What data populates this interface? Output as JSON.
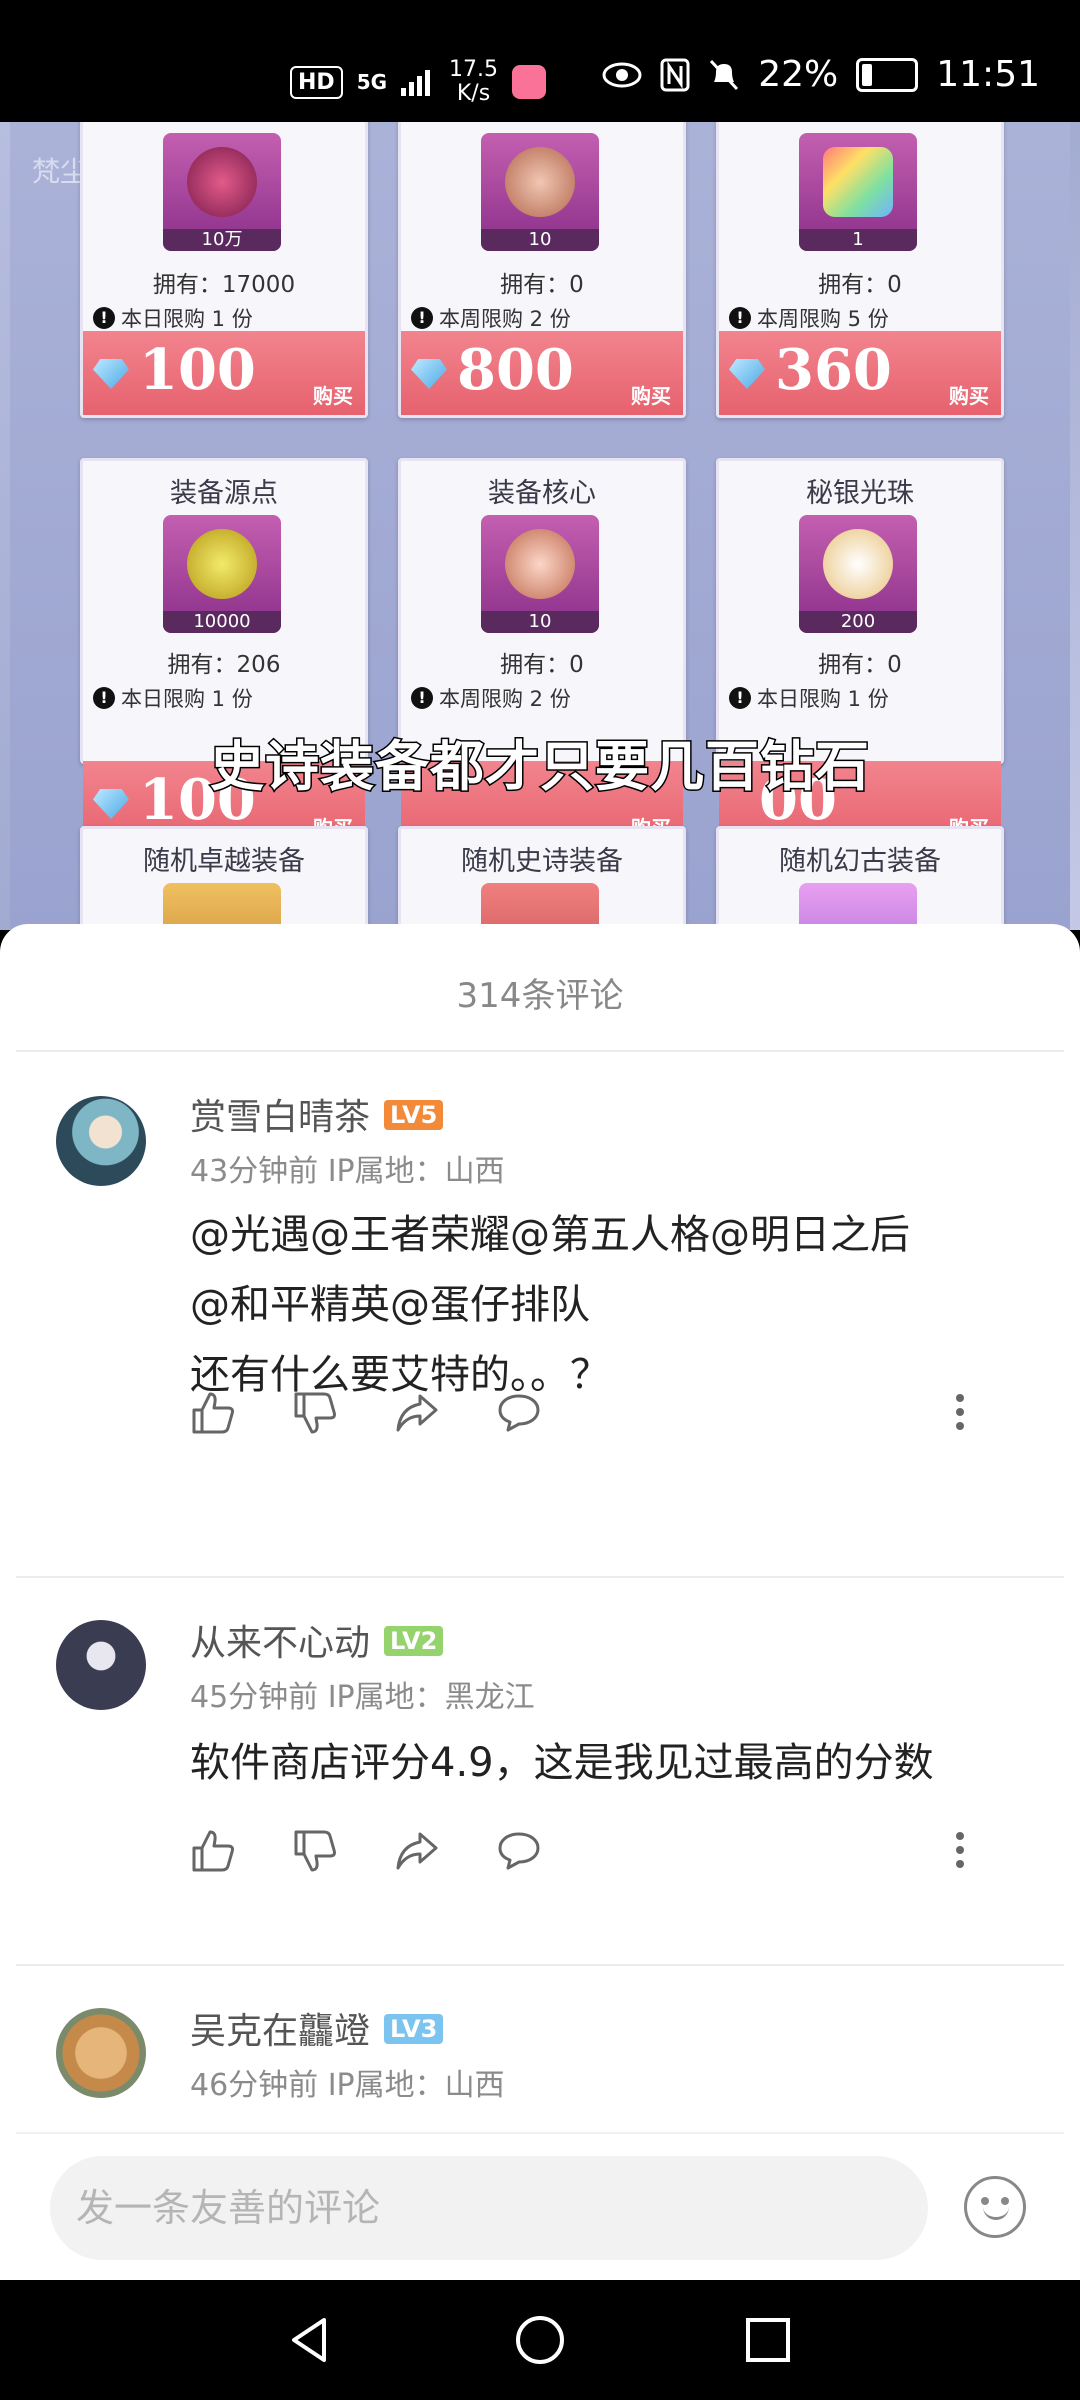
{
  "status_bar": {
    "hd": "HD",
    "network": "5G",
    "net_speed_value": "17.5",
    "net_speed_unit": "K/s",
    "battery": "22%",
    "time": "11:51"
  },
  "video": {
    "watermark": "梵尘ฅ",
    "subtitle": "史诗装备都才只要几百钻石",
    "cards_row1": [
      {
        "count": "10万",
        "owned": "拥有：17000",
        "limit": "本日限购 1 份",
        "price": "100",
        "buy": "购买"
      },
      {
        "count": "10",
        "owned": "拥有：0",
        "limit": "本周限购 2 份",
        "price": "800",
        "buy": "购买"
      },
      {
        "count": "1",
        "owned": "拥有：0",
        "limit": "本周限购 5 份",
        "price": "360",
        "buy": "购买"
      }
    ],
    "cards_row2": [
      {
        "title": "装备源点",
        "count": "10000",
        "owned": "拥有：206",
        "limit": "本日限购 1 份",
        "price": "100",
        "buy": "购买"
      },
      {
        "title": "装备核心",
        "count": "10",
        "owned": "拥有：0",
        "limit": "本周限购 2 份",
        "price": "",
        "buy": "购买"
      },
      {
        "title": "秘银光珠",
        "count": "200",
        "owned": "拥有：0",
        "limit": "本日限购 1 份",
        "price": "00",
        "buy": "购买"
      }
    ],
    "cards_row3": [
      {
        "title": "随机卓越装备"
      },
      {
        "title": "随机史诗装备"
      },
      {
        "title": "随机幻古装备"
      }
    ]
  },
  "comments_sheet": {
    "title": "314条评论",
    "comments": [
      {
        "user": "赏雪白晴茶",
        "level": "LV5",
        "level_color": "#f28a3a",
        "meta": "43分钟前  IP属地：山西",
        "lines": [
          "@光遇@王者荣耀@第五人格@明日之后",
          "@和平精英@蛋仔排队",
          "还有什么要艾特的。。？"
        ]
      },
      {
        "user": "从来不心动",
        "level": "LV2",
        "level_color": "#95d36d",
        "meta": "45分钟前  IP属地：黑龙江",
        "lines": [
          "软件商店评分4.9，这是我见过最高的分数"
        ]
      },
      {
        "user": "吴克在龘竳",
        "level": "LV3",
        "level_color": "#7bc4f0",
        "meta": "46分钟前  IP属地：山西",
        "lines": []
      }
    ]
  },
  "input": {
    "placeholder": "发一条友善的评论"
  }
}
